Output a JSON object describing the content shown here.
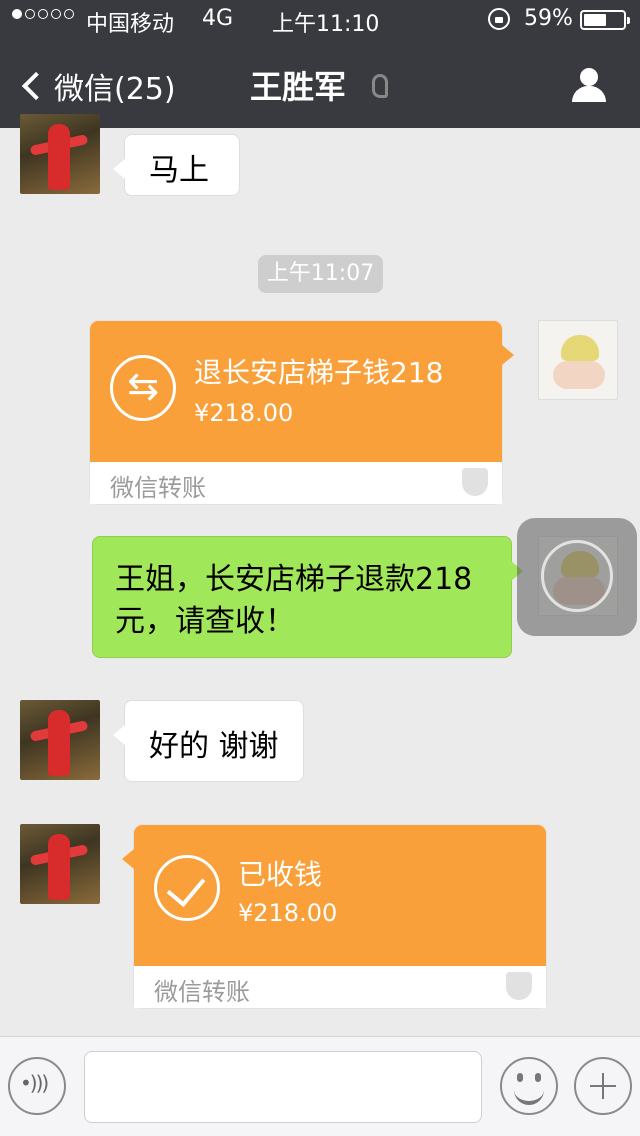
{
  "status_bar": {
    "signal_dots": 5,
    "signal_active": 1,
    "carrier": "中国移动",
    "network": "4G",
    "time": "上午11:10",
    "battery_pct": "59%",
    "battery_level": 0.59
  },
  "nav": {
    "back_label": "微信(25)",
    "title": "王胜军"
  },
  "chat": {
    "messages": [
      {
        "side": "left",
        "type": "text",
        "text": "马上"
      },
      {
        "type": "timestamp",
        "text": "上午11:07"
      },
      {
        "side": "right",
        "type": "transfer",
        "title": "退长安店梯子钱218",
        "amount": "¥218.00",
        "label": "微信转账"
      },
      {
        "side": "right",
        "type": "text",
        "line1": "王姐，长安店梯子退款218",
        "line2": "元，请查收！"
      },
      {
        "side": "left",
        "type": "text",
        "text": "好的 谢谢"
      },
      {
        "side": "left",
        "type": "transfer",
        "title": "已收钱",
        "amount": "¥218.00",
        "label": "微信转账"
      }
    ]
  },
  "input_bar": {
    "placeholder": ""
  },
  "colors": {
    "topbar": "#393a3f",
    "background": "#ebebeb",
    "green_bubble": "#a0e75a",
    "transfer_orange": "#f9a03b"
  }
}
